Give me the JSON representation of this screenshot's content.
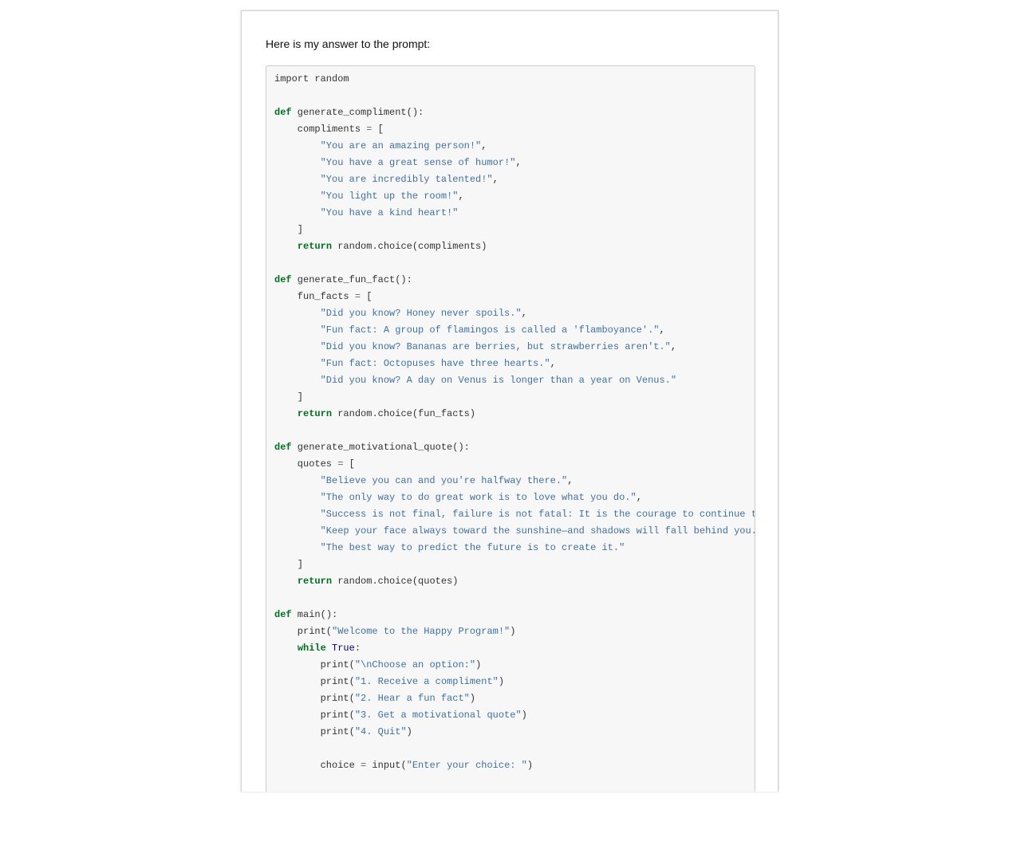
{
  "message": {
    "intro_text": "Here is my answer to the prompt:"
  },
  "code_block": {
    "language": "python",
    "colors": {
      "keyword": "#007020",
      "string": "#4070a0",
      "operator": "#666666",
      "constant": "#000080",
      "text": "#333333",
      "background": "#f7f7f7"
    },
    "lines": [
      [
        {
          "t": "import random",
          "c": "text"
        }
      ],
      [],
      [
        {
          "t": "def",
          "c": "kw"
        },
        {
          "t": " generate_compliment():",
          "c": "text"
        }
      ],
      [
        {
          "t": "    compliments ",
          "c": "text"
        },
        {
          "t": "=",
          "c": "op"
        },
        {
          "t": " [",
          "c": "text"
        }
      ],
      [
        {
          "t": "        ",
          "c": "text"
        },
        {
          "t": "\"You are an amazing person!\"",
          "c": "str"
        },
        {
          "t": ",",
          "c": "text"
        }
      ],
      [
        {
          "t": "        ",
          "c": "text"
        },
        {
          "t": "\"You have a great sense of humor!\"",
          "c": "str"
        },
        {
          "t": ",",
          "c": "text"
        }
      ],
      [
        {
          "t": "        ",
          "c": "text"
        },
        {
          "t": "\"You are incredibly talented!\"",
          "c": "str"
        },
        {
          "t": ",",
          "c": "text"
        }
      ],
      [
        {
          "t": "        ",
          "c": "text"
        },
        {
          "t": "\"You light up the room!\"",
          "c": "str"
        },
        {
          "t": ",",
          "c": "text"
        }
      ],
      [
        {
          "t": "        ",
          "c": "text"
        },
        {
          "t": "\"You have a kind heart!\"",
          "c": "str"
        }
      ],
      [
        {
          "t": "    ]",
          "c": "text"
        }
      ],
      [
        {
          "t": "    ",
          "c": "text"
        },
        {
          "t": "return",
          "c": "kw"
        },
        {
          "t": " random.choice(compliments)",
          "c": "text"
        }
      ],
      [],
      [
        {
          "t": "def",
          "c": "kw"
        },
        {
          "t": " generate_fun_fact():",
          "c": "text"
        }
      ],
      [
        {
          "t": "    fun_facts ",
          "c": "text"
        },
        {
          "t": "=",
          "c": "op"
        },
        {
          "t": " [",
          "c": "text"
        }
      ],
      [
        {
          "t": "        ",
          "c": "text"
        },
        {
          "t": "\"Did you know? Honey never spoils.\"",
          "c": "str"
        },
        {
          "t": ",",
          "c": "text"
        }
      ],
      [
        {
          "t": "        ",
          "c": "text"
        },
        {
          "t": "\"Fun fact: A group of flamingos is called a 'flamboyance'.\"",
          "c": "str"
        },
        {
          "t": ",",
          "c": "text"
        }
      ],
      [
        {
          "t": "        ",
          "c": "text"
        },
        {
          "t": "\"Did you know? Bananas are berries, but strawberries aren't.\"",
          "c": "str"
        },
        {
          "t": ",",
          "c": "text"
        }
      ],
      [
        {
          "t": "        ",
          "c": "text"
        },
        {
          "t": "\"Fun fact: Octopuses have three hearts.\"",
          "c": "str"
        },
        {
          "t": ",",
          "c": "text"
        }
      ],
      [
        {
          "t": "        ",
          "c": "text"
        },
        {
          "t": "\"Did you know? A day on Venus is longer than a year on Venus.\"",
          "c": "str"
        }
      ],
      [
        {
          "t": "    ]",
          "c": "text"
        }
      ],
      [
        {
          "t": "    ",
          "c": "text"
        },
        {
          "t": "return",
          "c": "kw"
        },
        {
          "t": " random.choice(fun_facts)",
          "c": "text"
        }
      ],
      [],
      [
        {
          "t": "def",
          "c": "kw"
        },
        {
          "t": " generate_motivational_quote():",
          "c": "text"
        }
      ],
      [
        {
          "t": "    quotes ",
          "c": "text"
        },
        {
          "t": "=",
          "c": "op"
        },
        {
          "t": " [",
          "c": "text"
        }
      ],
      [
        {
          "t": "        ",
          "c": "text"
        },
        {
          "t": "\"Believe you can and you're halfway there.\"",
          "c": "str"
        },
        {
          "t": ",",
          "c": "text"
        }
      ],
      [
        {
          "t": "        ",
          "c": "text"
        },
        {
          "t": "\"The only way to do great work is to love what you do.\"",
          "c": "str"
        },
        {
          "t": ",",
          "c": "text"
        }
      ],
      [
        {
          "t": "        ",
          "c": "text"
        },
        {
          "t": "\"Success is not final, failure is not fatal: It is the courage to continue t",
          "c": "str"
        }
      ],
      [
        {
          "t": "        ",
          "c": "text"
        },
        {
          "t": "\"Keep your face always toward the sunshine—and shadows will fall behind you.",
          "c": "str"
        }
      ],
      [
        {
          "t": "        ",
          "c": "text"
        },
        {
          "t": "\"The best way to predict the future is to create it.\"",
          "c": "str"
        }
      ],
      [
        {
          "t": "    ]",
          "c": "text"
        }
      ],
      [
        {
          "t": "    ",
          "c": "text"
        },
        {
          "t": "return",
          "c": "kw"
        },
        {
          "t": " random.choice(quotes)",
          "c": "text"
        }
      ],
      [],
      [
        {
          "t": "def",
          "c": "kw"
        },
        {
          "t": " main():",
          "c": "text"
        }
      ],
      [
        {
          "t": "    print(",
          "c": "text"
        },
        {
          "t": "\"Welcome to the Happy Program!\"",
          "c": "str"
        },
        {
          "t": ")",
          "c": "text"
        }
      ],
      [
        {
          "t": "    ",
          "c": "text"
        },
        {
          "t": "while",
          "c": "kw"
        },
        {
          "t": " ",
          "c": "text"
        },
        {
          "t": "True",
          "c": "const"
        },
        {
          "t": ":",
          "c": "text"
        }
      ],
      [
        {
          "t": "        print(",
          "c": "text"
        },
        {
          "t": "\"\\nChoose an option:\"",
          "c": "str"
        },
        {
          "t": ")",
          "c": "text"
        }
      ],
      [
        {
          "t": "        print(",
          "c": "text"
        },
        {
          "t": "\"1. Receive a compliment\"",
          "c": "str"
        },
        {
          "t": ")",
          "c": "text"
        }
      ],
      [
        {
          "t": "        print(",
          "c": "text"
        },
        {
          "t": "\"2. Hear a fun fact\"",
          "c": "str"
        },
        {
          "t": ")",
          "c": "text"
        }
      ],
      [
        {
          "t": "        print(",
          "c": "text"
        },
        {
          "t": "\"3. Get a motivational quote\"",
          "c": "str"
        },
        {
          "t": ")",
          "c": "text"
        }
      ],
      [
        {
          "t": "        print(",
          "c": "text"
        },
        {
          "t": "\"4. Quit\"",
          "c": "str"
        },
        {
          "t": ")",
          "c": "text"
        }
      ],
      [],
      [
        {
          "t": "        choice ",
          "c": "text"
        },
        {
          "t": "=",
          "c": "op"
        },
        {
          "t": " input(",
          "c": "text"
        },
        {
          "t": "\"Enter your choice: \"",
          "c": "str"
        },
        {
          "t": ")",
          "c": "text"
        }
      ]
    ]
  }
}
